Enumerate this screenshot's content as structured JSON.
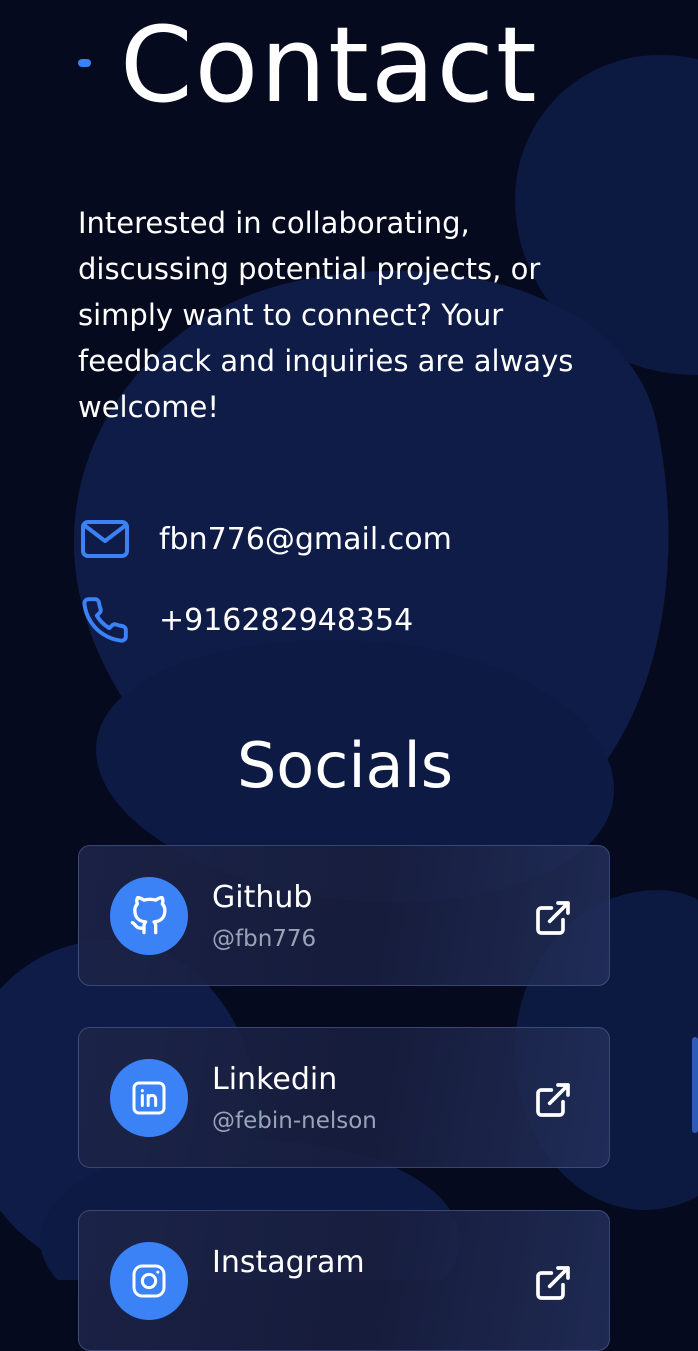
{
  "contact": {
    "title": "Contact",
    "intro": "Interested in collaborating, discussing potential projects, or simply want to connect? Your feedback and inquiries are always welcome!",
    "email": "fbn776@gmail.com",
    "phone": "+916282948354",
    "icons": [
      "mail-icon",
      "phone-icon"
    ]
  },
  "socials": {
    "title": "Socials",
    "items": [
      {
        "name": "Github",
        "handle": "@fbn776",
        "icon": "github-icon",
        "action_icon": "external-link-icon"
      },
      {
        "name": "Linkedin",
        "handle": "@febin-nelson",
        "icon": "linkedin-icon",
        "action_icon": "external-link-icon"
      },
      {
        "name": "Instagram",
        "handle": "",
        "icon": "instagram-icon",
        "action_icon": "external-link-icon"
      }
    ]
  },
  "colors": {
    "background": "#060a1f",
    "blob": "#0f1d48",
    "accent": "#3b82f6",
    "text": "#ffffff",
    "muted": "#9aa3b8"
  }
}
